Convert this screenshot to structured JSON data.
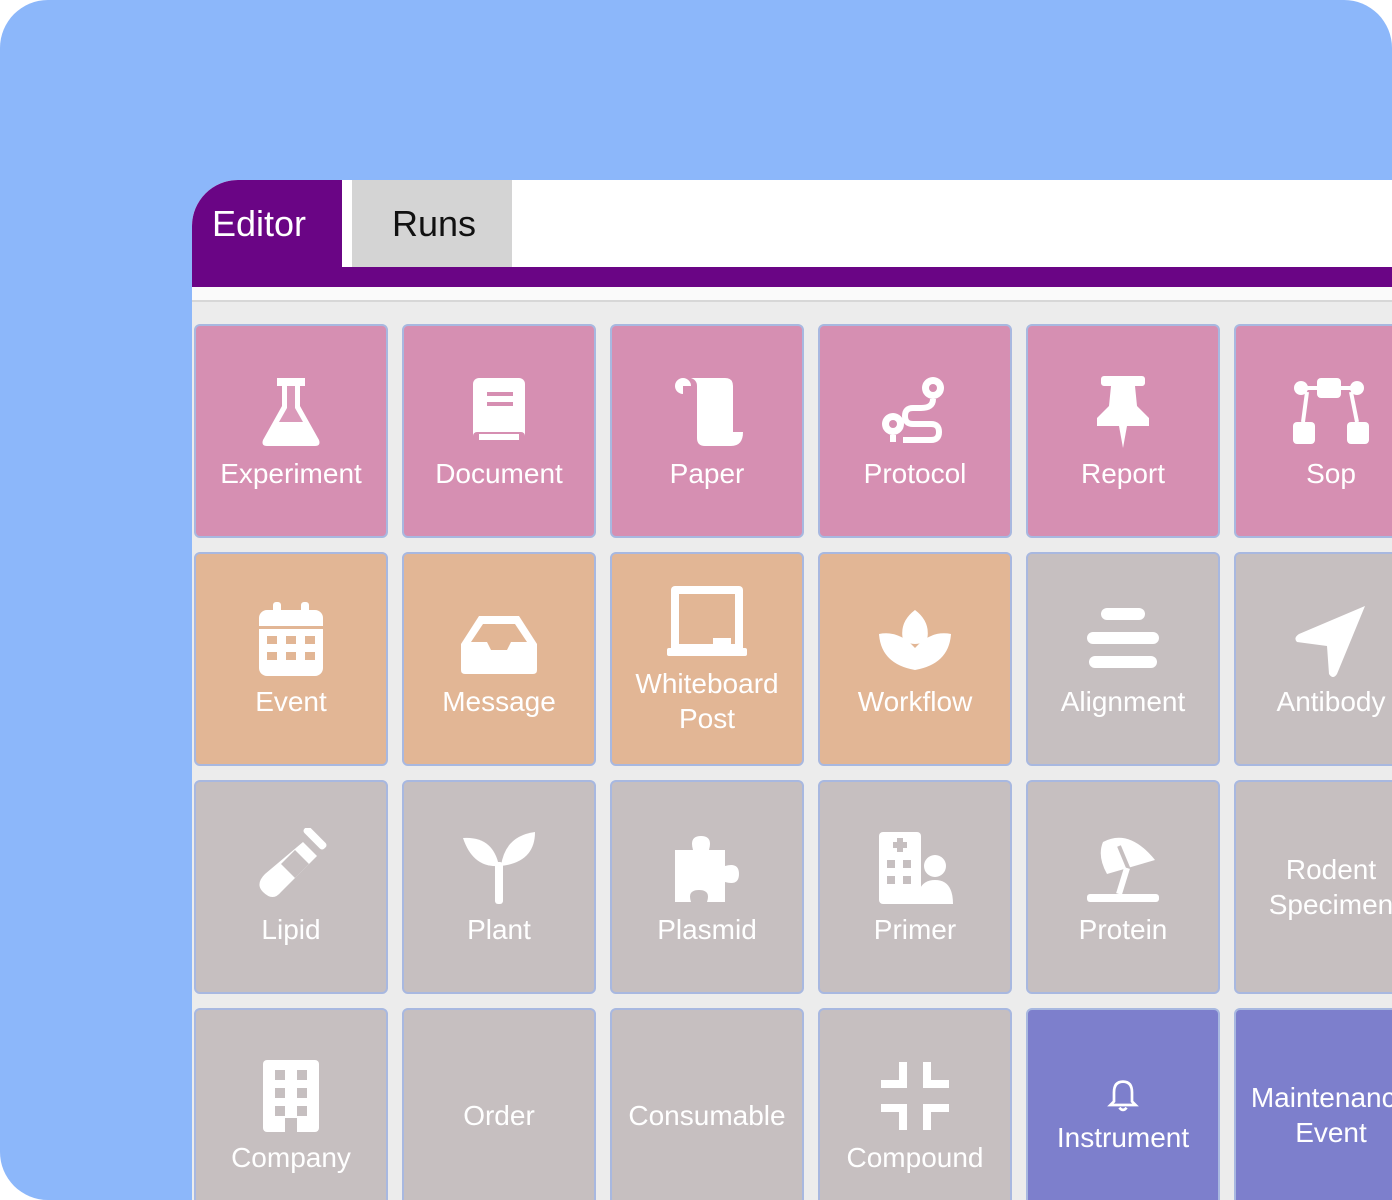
{
  "tabs": {
    "editor": "Editor",
    "runs": "Runs"
  },
  "colors": {
    "background": "#8cb7fa",
    "brand_purple": "#6a0585",
    "pink": "#d68fb2",
    "orange": "#e2b695",
    "grey": "#c6bfc0",
    "violet": "#7d7fcc"
  },
  "tiles": [
    {
      "label": "Experiment",
      "icon": "flask-icon",
      "color": "pink"
    },
    {
      "label": "Document",
      "icon": "book-icon",
      "color": "pink"
    },
    {
      "label": "Paper",
      "icon": "scroll-icon",
      "color": "pink"
    },
    {
      "label": "Protocol",
      "icon": "route-icon",
      "color": "pink"
    },
    {
      "label": "Report",
      "icon": "thumbtack-icon",
      "color": "pink"
    },
    {
      "label": "Sop",
      "icon": "diagram-project-icon",
      "color": "pink"
    },
    {
      "label": "Event",
      "icon": "calendar-icon",
      "color": "orange"
    },
    {
      "label": "Message",
      "icon": "inbox-icon",
      "color": "orange"
    },
    {
      "label": "Whiteboard Post",
      "icon": "chalkboard-icon",
      "color": "orange"
    },
    {
      "label": "Workflow",
      "icon": "spa-icon",
      "color": "orange"
    },
    {
      "label": "Alignment",
      "icon": "align-center-icon",
      "color": "grey"
    },
    {
      "label": "Antibody",
      "icon": "location-arrow-icon",
      "color": "grey"
    },
    {
      "label": "Lipid",
      "icon": "test-tube-icon",
      "color": "grey"
    },
    {
      "label": "Plant",
      "icon": "seedling-icon",
      "color": "grey"
    },
    {
      "label": "Plasmid",
      "icon": "puzzle-piece-icon",
      "color": "grey"
    },
    {
      "label": "Primer",
      "icon": "hospital-user-icon",
      "color": "grey"
    },
    {
      "label": "Protein",
      "icon": "umbrella-beach-icon",
      "color": "grey"
    },
    {
      "label": "Rodent Specimen",
      "icon": "",
      "color": "grey"
    },
    {
      "label": "Company",
      "icon": "building-icon",
      "color": "grey"
    },
    {
      "label": "Order",
      "icon": "",
      "color": "grey"
    },
    {
      "label": "Consumable",
      "icon": "",
      "color": "grey"
    },
    {
      "label": "Compound",
      "icon": "compress-icon",
      "color": "grey"
    },
    {
      "label": "Instrument",
      "icon": "bell-icon",
      "color": "violet"
    },
    {
      "label": "Maintenance Event",
      "icon": "",
      "color": "violet"
    }
  ]
}
